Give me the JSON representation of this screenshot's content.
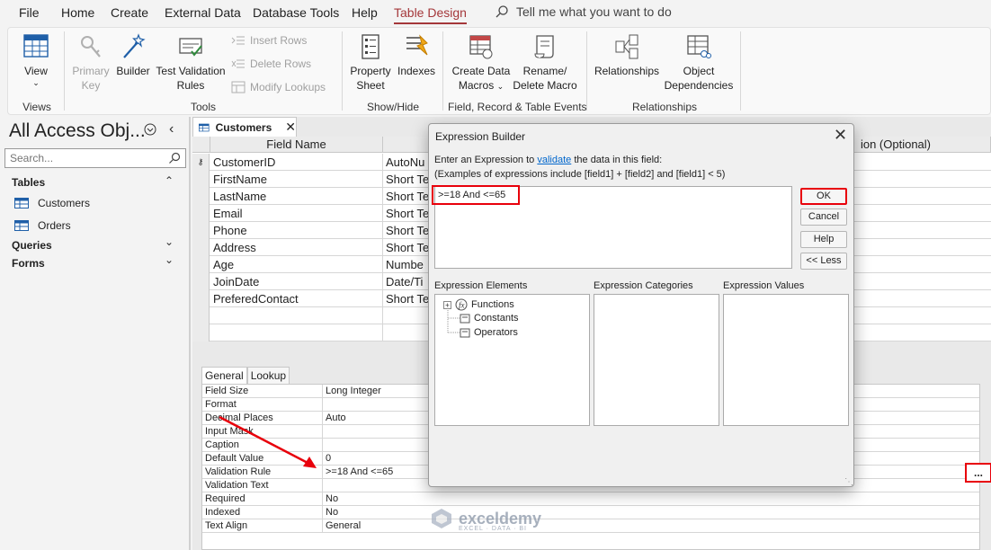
{
  "menu": {
    "items": [
      "File",
      "Home",
      "Create",
      "External Data",
      "Database Tools",
      "Help",
      "Table Design"
    ],
    "active": "Table Design",
    "tell_me": "Tell me what you want to do"
  },
  "ribbon": {
    "view": "View",
    "primary_key_1": "Primary",
    "primary_key_2": "Key",
    "builder": "Builder",
    "test_validation_1": "Test Validation",
    "test_validation_2": "Rules",
    "insert_rows": "Insert Rows",
    "delete_rows": "Delete Rows",
    "modify_lookups": "Modify Lookups",
    "property_sheet_1": "Property",
    "property_sheet_2": "Sheet",
    "indexes": "Indexes",
    "create_data_macros_1": "Create Data",
    "create_data_macros_2": "Macros",
    "rename_delete_1": "Rename/",
    "rename_delete_2": "Delete Macro",
    "relationships": "Relationships",
    "object_dependencies_1": "Object",
    "object_dependencies_2": "Dependencies",
    "groups": {
      "views": "Views",
      "tools": "Tools",
      "show_hide": "Show/Hide",
      "field_record": "Field, Record & Table Events",
      "relationships": "Relationships"
    }
  },
  "nav": {
    "title": "All Access Obj...",
    "search_placeholder": "Search...",
    "tables_label": "Tables",
    "tables": [
      "Customers",
      "Orders"
    ],
    "queries_label": "Queries",
    "forms_label": "Forms"
  },
  "document": {
    "tab": "Customers",
    "headers": {
      "field_name": "Field Name",
      "description": "ion (Optional)"
    },
    "fields": [
      {
        "name": "CustomerID",
        "type": "AutoNu"
      },
      {
        "name": "FirstName",
        "type": "Short Te"
      },
      {
        "name": "LastName",
        "type": "Short Te"
      },
      {
        "name": "Email",
        "type": "Short Te"
      },
      {
        "name": "Phone",
        "type": "Short Te"
      },
      {
        "name": "Address",
        "type": "Short Te"
      },
      {
        "name": "Age",
        "type": "Numbe"
      },
      {
        "name": "JoinDate",
        "type": "Date/Ti"
      },
      {
        "name": "PreferedContact",
        "type": "Short Te"
      }
    ]
  },
  "properties": {
    "tabs": [
      "General",
      "Lookup"
    ],
    "rows": [
      {
        "label": "Field Size",
        "value": "Long Integer"
      },
      {
        "label": "Format",
        "value": ""
      },
      {
        "label": "Decimal Places",
        "value": "Auto"
      },
      {
        "label": "Input Mask",
        "value": ""
      },
      {
        "label": "Caption",
        "value": ""
      },
      {
        "label": "Default Value",
        "value": "0"
      },
      {
        "label": "Validation Rule",
        "value": ">=18 And <=65"
      },
      {
        "label": "Validation Text",
        "value": ""
      },
      {
        "label": "Required",
        "value": "No"
      },
      {
        "label": "Indexed",
        "value": "No"
      },
      {
        "label": "Text Align",
        "value": "General"
      }
    ],
    "builder_button": "..."
  },
  "dialog": {
    "title": "Expression Builder",
    "prompt_before": "Enter an Expression to",
    "prompt_link": "validate",
    "prompt_after": "the data in this field:",
    "examples": "(Examples of expressions include [field1] + [field2] and [field1] < 5)",
    "expression": ">=18 And <=65",
    "buttons": {
      "ok": "OK",
      "cancel": "Cancel",
      "help": "Help",
      "less": "<< Less"
    },
    "panels": {
      "elements": "Expression Elements",
      "categories": "Expression Categories",
      "values": "Expression Values"
    },
    "elements": [
      "Functions",
      "Constants",
      "Operators"
    ]
  },
  "watermark": {
    "name": "exceldemy",
    "tagline": "EXCEL · DATA · BI"
  },
  "colors": {
    "accent": "#a4373a",
    "highlight": "#e8000b",
    "link": "#0066cc"
  }
}
